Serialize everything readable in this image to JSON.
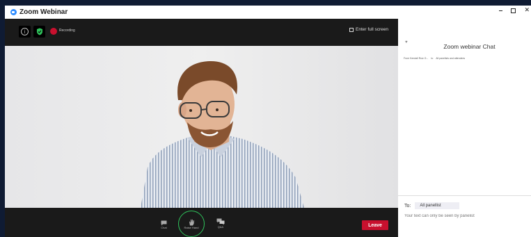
{
  "window": {
    "title": "Zoom Webinar"
  },
  "top_toolbar": {
    "recording_label": "Recording",
    "fullscreen_label": "Enter full screen"
  },
  "bottom_toolbar": {
    "chat_label": "Chat",
    "raise_hand_label": "Raise Hand",
    "qa_label": "Q&A",
    "leave_label": "Leave"
  },
  "chat_panel": {
    "title": "Zoom webinar Chat",
    "from_label": "From Kendall Ruiz G...",
    "to_word": "to",
    "audience": "All panelists and attendees",
    "to_label": "To:",
    "to_selected": "All panellist",
    "input_placeholder": "Your text can only be seen by panelist"
  },
  "colors": {
    "leave": "#c8102e",
    "recording": "#c8102e",
    "raise_hand_ring": "#2fc25b",
    "accent": "#2d8cff"
  }
}
